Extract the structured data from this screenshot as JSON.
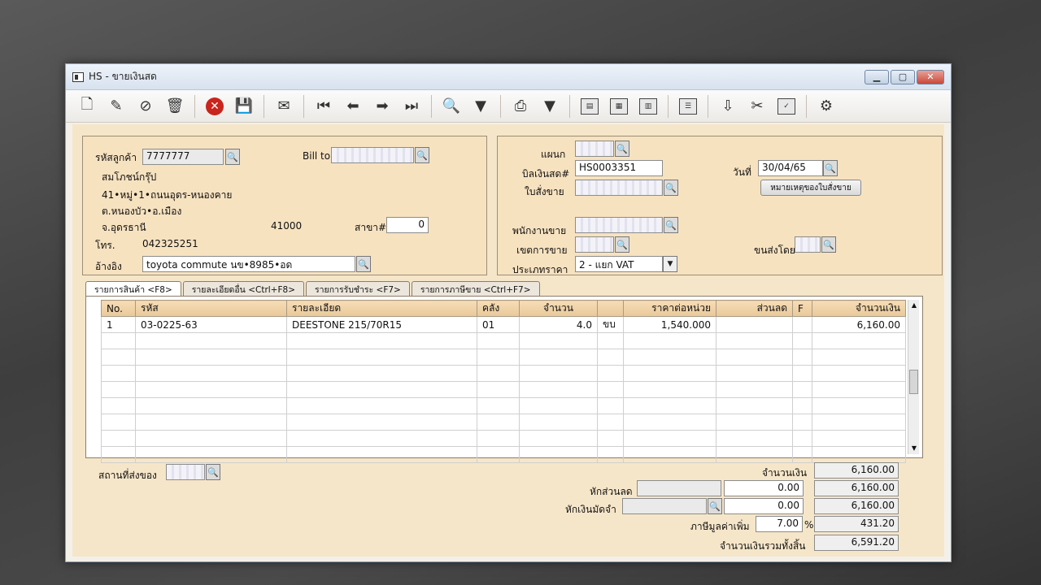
{
  "window": {
    "title": "HS - ขายเงินสด",
    "minimize": "▁",
    "maximize": "▢",
    "close": "✕"
  },
  "toolbar": [
    {
      "name": "new-icon",
      "glyph": "🗋"
    },
    {
      "name": "edit-icon",
      "glyph": "✎"
    },
    {
      "name": "void-icon",
      "glyph": "⊘"
    },
    {
      "name": "trash-icon",
      "glyph": "🗑"
    },
    {
      "name": "cancel-icon",
      "glyph": "✕"
    },
    {
      "name": "save-icon",
      "glyph": "💾"
    },
    {
      "name": "notes-icon",
      "glyph": "✉"
    },
    {
      "name": "first-record-icon",
      "glyph": "⏮"
    },
    {
      "name": "prev-record-icon",
      "glyph": "⬅"
    },
    {
      "name": "next-record-icon",
      "glyph": "➡"
    },
    {
      "name": "last-record-icon",
      "glyph": "⏭"
    },
    {
      "name": "find-icon",
      "glyph": "🔍"
    },
    {
      "name": "print-icon",
      "glyph": "⎙"
    }
  ],
  "customer": {
    "code_label": "รหัสลูกค้า",
    "code": "7777777",
    "name": "สมโภชน์กรุ๊ป",
    "addr1": "41•หมู่•1•ถนนอุดร-หนองคาย",
    "addr2": "ต.หนองบัว•อ.เมือง",
    "addr3": "จ.อุดรธานี",
    "zip": "41000",
    "branch_label": "สาขา#",
    "branch": "0",
    "tel_label": "โทร.",
    "tel": "042325251",
    "ref_label": "อ้างอิง",
    "ref": "toyota commute นข•8985•อด",
    "bill_to_label": "Bill to"
  },
  "doc": {
    "dept_label": "แผนก",
    "bill_label": "บิลเงินสด#",
    "bill_no": "HS0003351",
    "order_label": "ใบสั่งขาย",
    "date_label": "วันที่",
    "date": "30/04/65",
    "remark_button": "หมายเหตุของใบสั่งขาย",
    "sales_label": "พนักงานขาย",
    "area_label": "เขตการขาย",
    "ship_label": "ขนส่งโดย",
    "price_type_label": "ประเภทราคา",
    "price_type": "2 - แยก VAT"
  },
  "tabs": [
    "รายการสินค้า <F8>",
    "รายละเอียดอื่น <Ctrl+F8>",
    "รายการรับชำระ <F7>",
    "รายการภาษีขาย <Ctrl+F7>"
  ],
  "grid": {
    "headers": [
      "No.",
      "รหัส",
      "รายละเอียด",
      "คลัง",
      "จำนวน",
      "",
      "ราคาต่อหน่วย",
      "ส่วนลด",
      "F",
      "จำนวนเงิน"
    ],
    "rows": [
      [
        "1",
        "03-0225-63",
        "DEESTONE 215/70R15",
        "01",
        "4.0",
        "ขบ",
        "1,540.000",
        "",
        "",
        "6,160.00"
      ]
    ],
    "empty_rows": 8
  },
  "footer": {
    "deliver_label": "สถานที่ส่งของ",
    "amount_label": "จำนวนเงิน",
    "amount": "6,160.00",
    "discount_label": "หักส่วนลด",
    "discount": "0.00",
    "after_discount": "6,160.00",
    "deposit_label": "หักเงินมัดจำ",
    "deposit": "0.00",
    "after_deposit": "6,160.00",
    "vat_label": "ภาษีมูลค่าเพิ่ม",
    "vat_rate": "7.00",
    "vat_pct": "%",
    "vat_amount": "431.20",
    "total_label": "จำนวนเงินรวมทั้งสิ้น",
    "total": "6,591.20"
  }
}
